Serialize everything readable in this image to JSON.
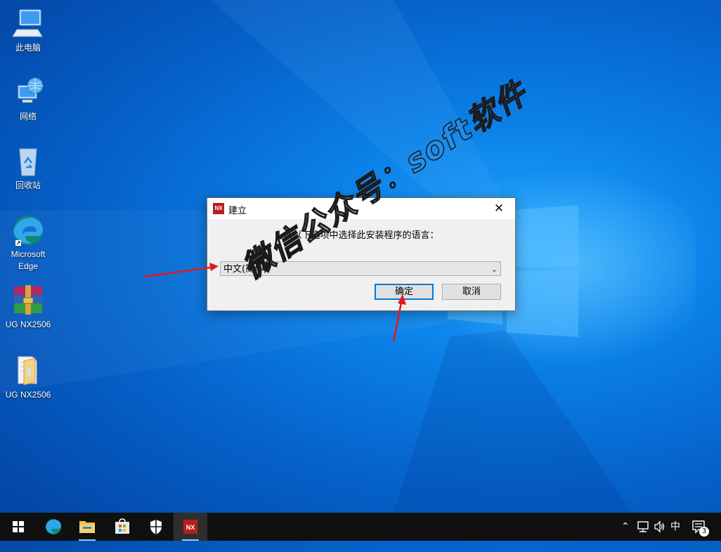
{
  "desktop": {
    "icons": [
      {
        "label": "此电脑",
        "icon": "computer-icon"
      },
      {
        "label": "网络",
        "icon": "network-icon"
      },
      {
        "label": "回收站",
        "icon": "recycle-bin-icon"
      },
      {
        "label": "Microsoft Edge",
        "icon": "edge-icon"
      },
      {
        "label": "UG NX2506",
        "icon": "winrar-archive-icon"
      },
      {
        "label": "UG NX2506",
        "icon": "folder-icon"
      }
    ]
  },
  "dialog": {
    "title": "建立",
    "close_glyph": "✕",
    "prompt": "从以下选项中选择此安装程序的语言：",
    "language_selected": "中文(简体)",
    "ok_label": "确定",
    "cancel_label": "取消"
  },
  "watermark": "微信公众号：soft软件",
  "taskbar": {
    "apps": [
      "start-icon",
      "edge-icon",
      "file-explorer-icon",
      "store-icon",
      "security-icon",
      "nx-icon"
    ],
    "ime": "中",
    "notification_count": "3"
  },
  "colors": {
    "accent": "#0078d7",
    "annotation_arrow": "#e0191b",
    "nx_brand": "#b3201e"
  }
}
